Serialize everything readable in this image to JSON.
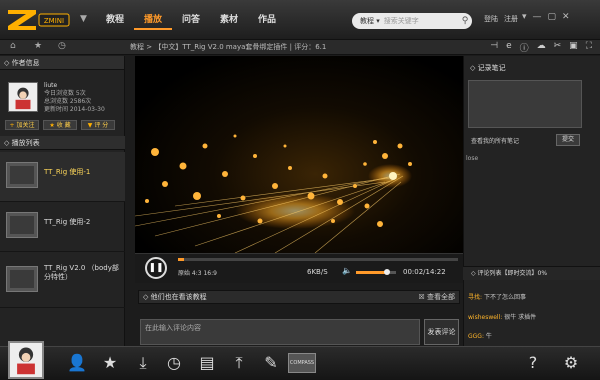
{
  "app": {
    "logo_text": "ZMINI"
  },
  "nav": {
    "items": [
      {
        "label": "教程"
      },
      {
        "label": "播放"
      },
      {
        "label": "问答"
      },
      {
        "label": "素材"
      },
      {
        "label": "作品"
      }
    ],
    "active_index": 1
  },
  "search": {
    "category": "教程",
    "placeholder": "搜索关键字"
  },
  "header_links": {
    "login": "登陆",
    "register": "注册"
  },
  "breadcrumb": "教程 > 【中文】TT_Rig V2.0 maya套骨绑定插件 | 评分：6.1",
  "author_panel": {
    "title": "作者信息",
    "name": "liute",
    "stats": [
      "今日浏览数 5次",
      "总浏览数 2586次",
      "更新时间 2014-03-30"
    ],
    "buttons": [
      {
        "icon": "+",
        "label": "加关注"
      },
      {
        "icon": "★",
        "label": "收 藏"
      },
      {
        "icon": "▼",
        "label": "评 分"
      }
    ]
  },
  "playlist": {
    "title": "播放列表",
    "items": [
      {
        "title": "TT_Rig 使用-1"
      },
      {
        "title": "TT_Rig 使用-2"
      },
      {
        "title": "TT_Rig V2.0 （body部分特性）"
      }
    ],
    "active_index": 0
  },
  "player": {
    "quality_text": "原始  4:3  16:9",
    "speed": "6KB/S",
    "time": "00:02/14:22",
    "progress": 0.02,
    "volume": 0.78
  },
  "viewers": {
    "title": "他们也在看该教程",
    "view_all": "查看全部"
  },
  "comment": {
    "placeholder": "在此输入评论内容",
    "submit": "发表评论"
  },
  "notes": {
    "title": "记录笔记",
    "view_all": "查看我的所有笔记",
    "submit": "提交",
    "user": "lose"
  },
  "comments": {
    "title": "评论列表【即时交流】0%",
    "items": [
      {
        "user": "寻找:",
        "text": "下不了怎么回事"
      },
      {
        "user": "wisheswell:",
        "text": "很牛 求插件"
      },
      {
        "user": "GGG:",
        "text": "牛"
      }
    ]
  },
  "bottom_bar": {
    "compass_label": "COMPASS"
  },
  "colors": {
    "accent": "#ff9a2a",
    "username": "#ffb52a"
  }
}
